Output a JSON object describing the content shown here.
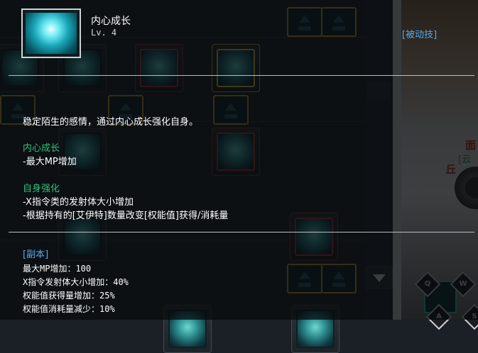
{
  "skill": {
    "name": "内心成长",
    "level": "Lv. 4",
    "type_tag": "[被动技]",
    "description": "稳定陌生的感情，通过内心成长强化自身。"
  },
  "sections": [
    {
      "heading": "内心成长",
      "lines": [
        "-最大MP增加"
      ]
    },
    {
      "heading": "自身强化",
      "lines": [
        "-X指令类的发射体大小增加",
        "-根据持有的[艾伊特]数量改变[权能值]获得/消耗量"
      ]
    }
  ],
  "dungeon": {
    "heading": "[副本]",
    "stats": [
      "最大MP增加：100",
      "X指令发射体大小增加：40%",
      "权能值获得量增加：25%",
      "权能值消耗量减少：10%"
    ]
  },
  "scene": {
    "red_text_1": "面",
    "red_text_2": "丘",
    "green_text": "[云",
    "hotkeys": [
      "Q",
      "W",
      "A",
      "S"
    ]
  },
  "colors": {
    "section_heading": "#2fc17a",
    "tag_blue": "#58a8e8",
    "overlay": "rgba(6,9,12,0.76)"
  }
}
